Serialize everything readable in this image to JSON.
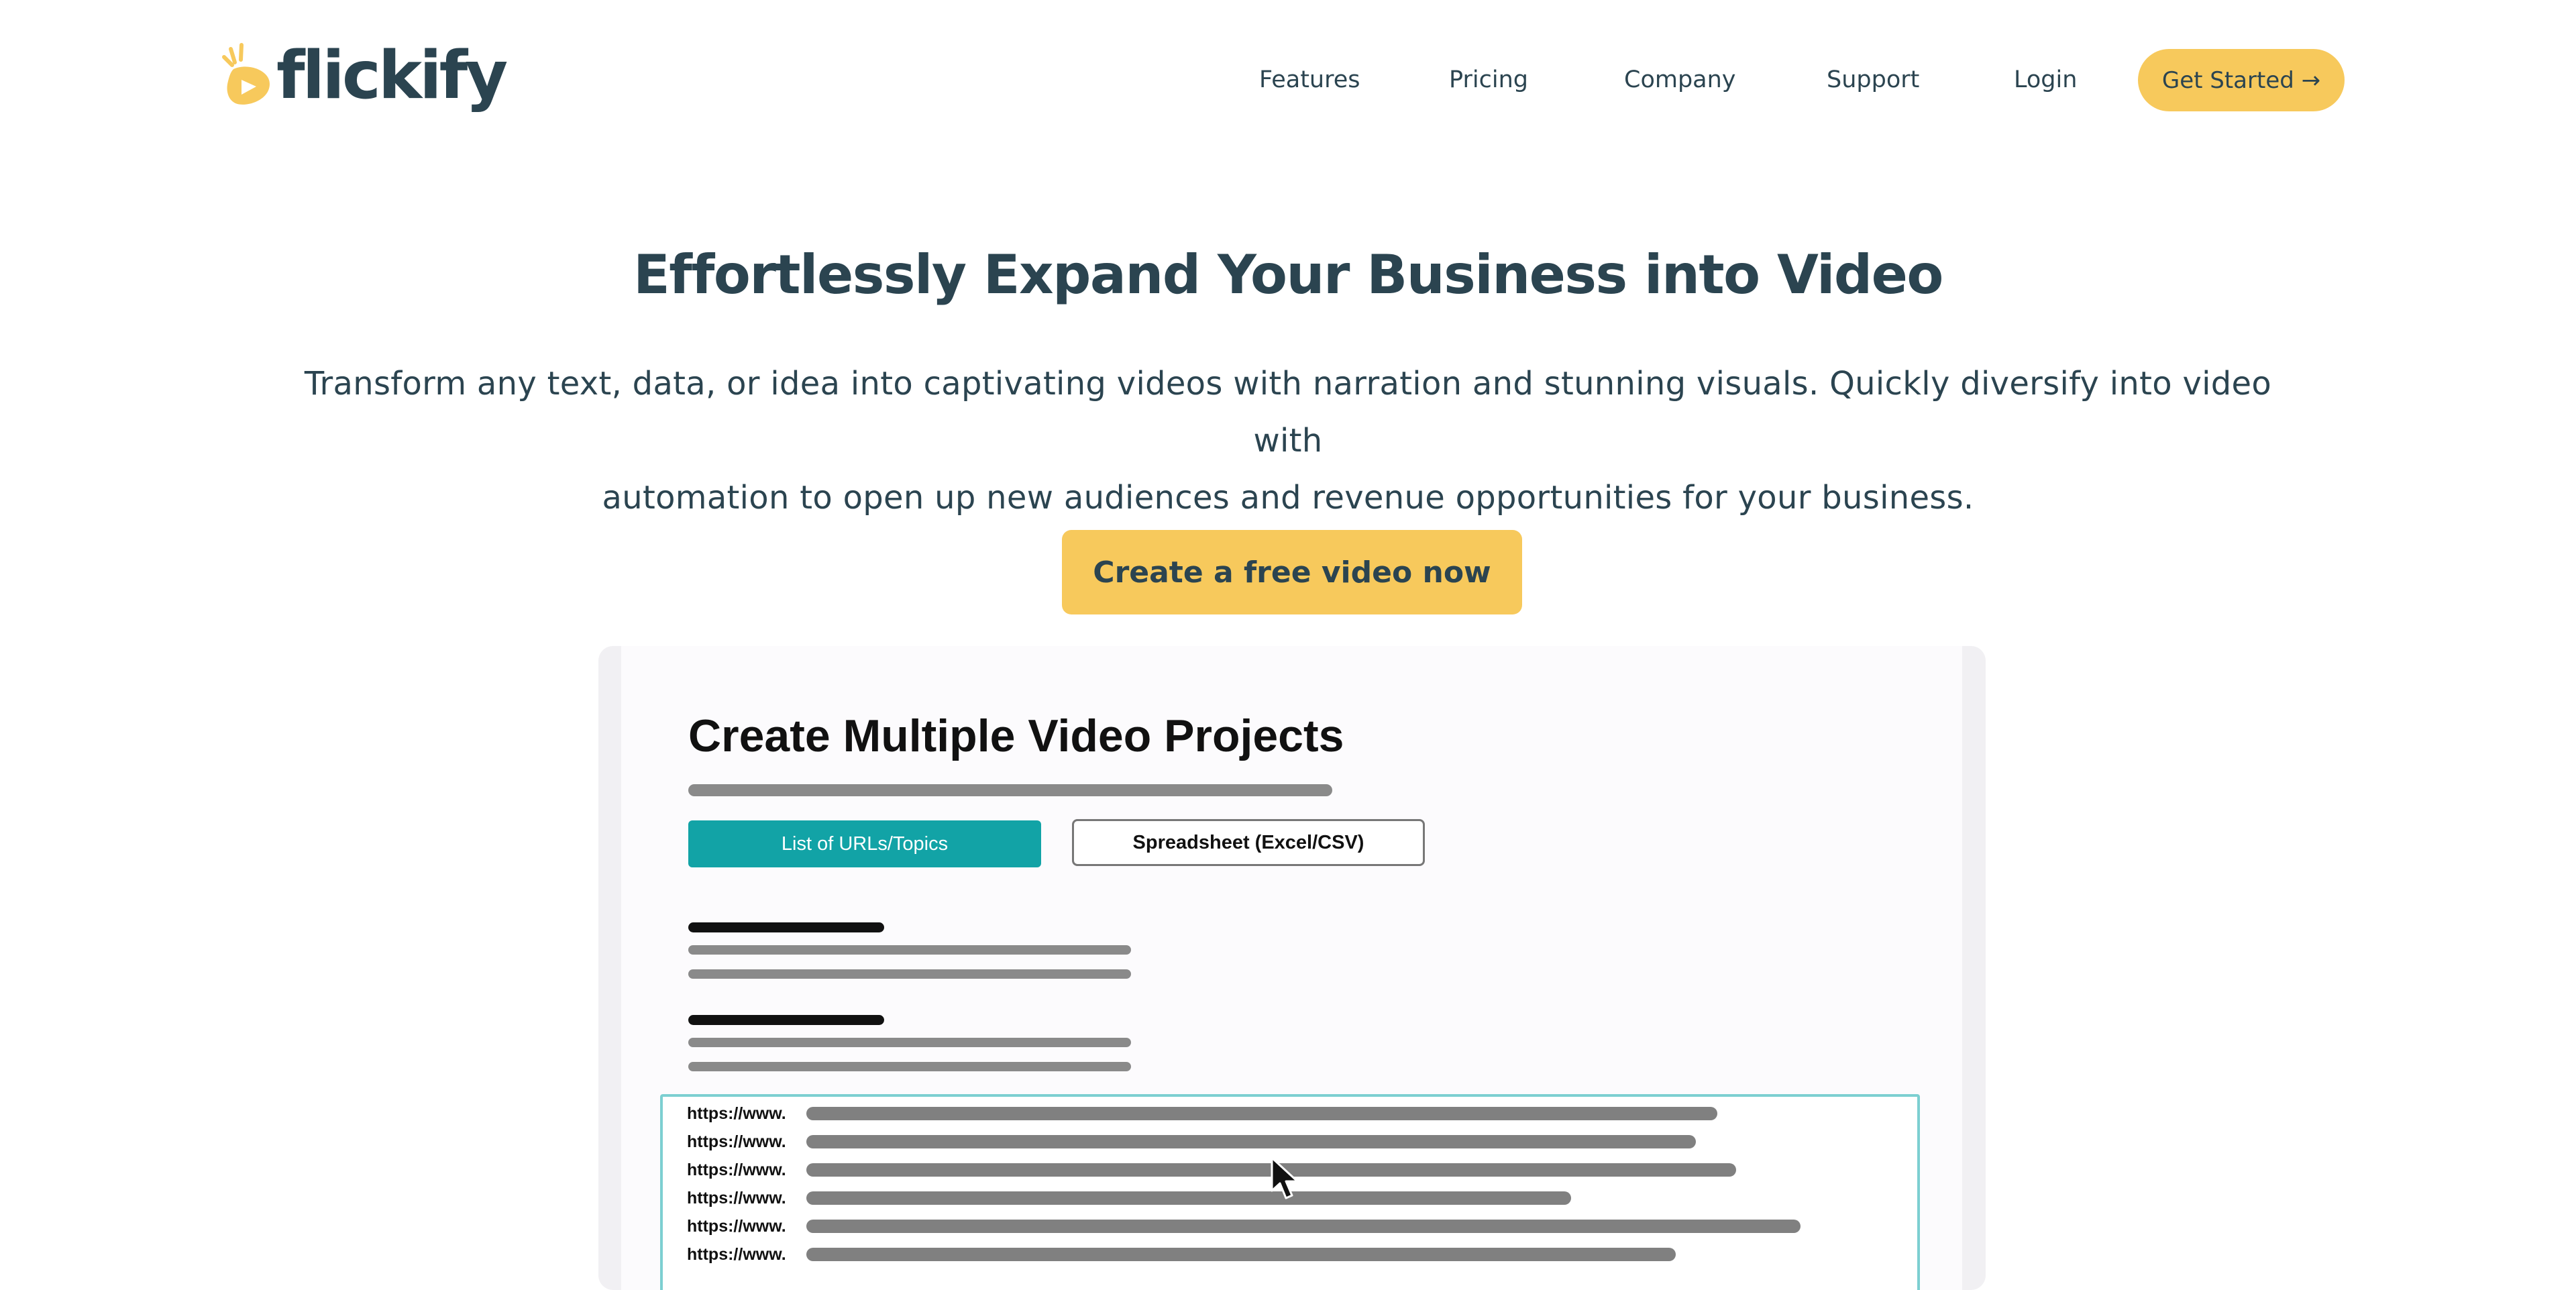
{
  "brand": {
    "name": "flickify",
    "accent": "#f7c95c",
    "text_color": "#2b4450",
    "teal": "#12a3a6"
  },
  "nav": {
    "items": [
      "Features",
      "Pricing",
      "Company",
      "Support",
      "Login"
    ],
    "cta": "Get Started →"
  },
  "hero": {
    "title": "Effortlessly Expand Your Business into Video",
    "subtitle_line1": "Transform any text, data, or idea into captivating videos with narration and stunning visuals.  Quickly diversify into video with",
    "subtitle_line2": "automation to open up new audiences and revenue opportunities for your business.",
    "cta": "Create a free video now"
  },
  "mockup": {
    "title": "Create Multiple Video Projects",
    "tabs": [
      {
        "label": "List of URLs/Topics",
        "active": true
      },
      {
        "label": "Spreadsheet (Excel/CSV)",
        "active": false
      }
    ],
    "url_rows": [
      "https://www.",
      "https://www.",
      "https://www.",
      "https://www.",
      "https://www.",
      "https://www."
    ],
    "cursor_icon": "mouse-pointer-icon"
  }
}
